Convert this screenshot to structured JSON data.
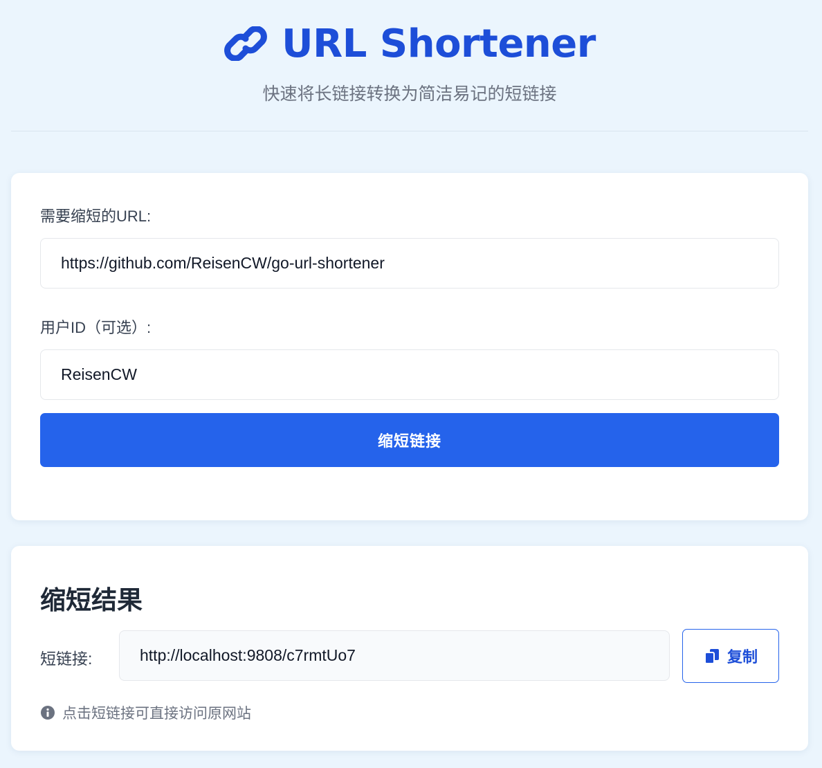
{
  "header": {
    "icon": "link-icon",
    "title": "URL Shortener",
    "subtitle": "快速将长链接转换为简洁易记的短链接"
  },
  "form": {
    "url_label": "需要缩短的URL:",
    "url_value": "https://github.com/ReisenCW/go-url-shortener",
    "user_label": "用户ID（可选）:",
    "user_value": "ReisenCW",
    "submit_label": "缩短链接"
  },
  "result": {
    "title": "缩短结果",
    "short_label": "短链接:",
    "short_url": "http://localhost:9808/c7rmtUo7",
    "copy_icon": "copy-icon",
    "copy_label": "复制",
    "hint_icon": "info-icon",
    "hint_text": "点击短链接可直接访问原网站"
  },
  "colors": {
    "accent": "#2563eb",
    "title": "#1d4ed8",
    "background": "#ebf5fd"
  }
}
